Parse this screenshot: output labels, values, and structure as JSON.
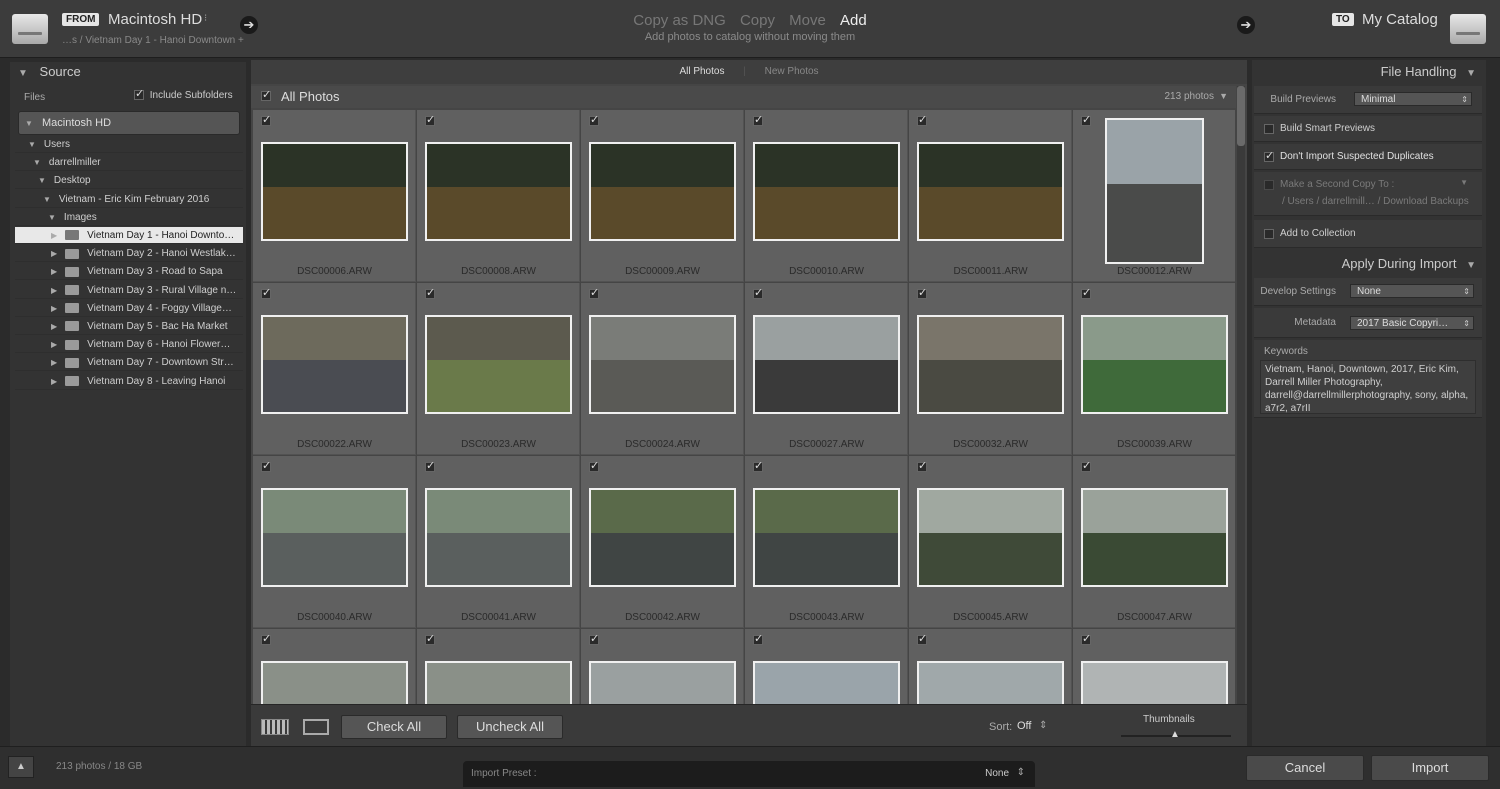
{
  "top": {
    "from_tag": "FROM",
    "from_volume": "Macintosh HD",
    "from_path": "…s / Vietnam Day 1 - Hanoi Downtown +",
    "modes": [
      "Copy as DNG",
      "Copy",
      "Move",
      "Add"
    ],
    "active_mode": "Add",
    "mode_description": "Add photos to catalog without moving them",
    "to_tag": "TO",
    "to_destination": "My Catalog"
  },
  "source": {
    "title": "Source",
    "files_label": "Files",
    "include_subfolders": "Include Subfolders",
    "volume": "Macintosh HD",
    "tree": [
      {
        "label": "Users",
        "indent": 1,
        "kind": "node"
      },
      {
        "label": "darrellmiller",
        "indent": 2,
        "kind": "node"
      },
      {
        "label": "Desktop",
        "indent": 3,
        "kind": "node"
      },
      {
        "label": "Vietnam - Eric Kim February 2016",
        "indent": 4,
        "kind": "node"
      },
      {
        "label": "Images",
        "indent": 5,
        "kind": "node"
      },
      {
        "label": "Vietnam Day 1 - Hanoi Downto…",
        "indent": 6,
        "kind": "folder",
        "selected": true
      },
      {
        "label": "Vietnam Day 2 - Hanoi Westlak…",
        "indent": 6,
        "kind": "folder"
      },
      {
        "label": "Vietnam Day 3 - Road to Sapa",
        "indent": 6,
        "kind": "folder"
      },
      {
        "label": "Vietnam Day 3 - Rural Village n…",
        "indent": 6,
        "kind": "folder"
      },
      {
        "label": "Vietnam Day 4 - Foggy Village…",
        "indent": 6,
        "kind": "folder"
      },
      {
        "label": "Vietnam Day 5 - Bac Ha Market",
        "indent": 6,
        "kind": "folder"
      },
      {
        "label": "Vietnam Day 6 - Hanoi Flower…",
        "indent": 6,
        "kind": "folder"
      },
      {
        "label": "Vietnam Day 7 - Downtown Str…",
        "indent": 6,
        "kind": "folder"
      },
      {
        "label": "Vietnam Day 8 - Leaving Hanoi",
        "indent": 6,
        "kind": "folder"
      }
    ]
  },
  "view_tabs": [
    "All Photos",
    "New Photos"
  ],
  "grid": {
    "header_label": "All Photos",
    "count": "213 photos",
    "rows": [
      [
        {
          "name": "DSC00006.ARW",
          "sky": "#2b3326",
          "ground": "#5a4a2a"
        },
        {
          "name": "DSC00008.ARW",
          "sky": "#2b3326",
          "ground": "#5a4a2a"
        },
        {
          "name": "DSC00009.ARW",
          "sky": "#2b3326",
          "ground": "#5a4a2a"
        },
        {
          "name": "DSC00010.ARW",
          "sky": "#2b3326",
          "ground": "#5a4a2a"
        },
        {
          "name": "DSC00011.ARW",
          "sky": "#2b3326",
          "ground": "#5a4a2a"
        },
        {
          "name": "DSC00012.ARW",
          "sky": "#9aa3a8",
          "ground": "#4a4b4a",
          "portrait": true
        }
      ],
      [
        {
          "name": "DSC00022.ARW",
          "sky": "#6d6a5c",
          "ground": "#4a4c52"
        },
        {
          "name": "DSC00023.ARW",
          "sky": "#5c5a4e",
          "ground": "#6a7a4a"
        },
        {
          "name": "DSC00024.ARW",
          "sky": "#7a7c78",
          "ground": "#5a5a56"
        },
        {
          "name": "DSC00027.ARW",
          "sky": "#9aa0a0",
          "ground": "#3a3a3a"
        },
        {
          "name": "DSC00032.ARW",
          "sky": "#7a756a",
          "ground": "#4a4a42"
        },
        {
          "name": "DSC00039.ARW",
          "sky": "#8a9a8a",
          "ground": "#3f6a3a"
        }
      ],
      [
        {
          "name": "DSC00040.ARW",
          "sky": "#7a8a78",
          "ground": "#5a5f5e"
        },
        {
          "name": "DSC00041.ARW",
          "sky": "#7a8a78",
          "ground": "#5a5f5e"
        },
        {
          "name": "DSC00042.ARW",
          "sky": "#5a6a4a",
          "ground": "#404544"
        },
        {
          "name": "DSC00043.ARW",
          "sky": "#5a6a4a",
          "ground": "#404544"
        },
        {
          "name": "DSC00045.ARW",
          "sky": "#a0a8a0",
          "ground": "#3f4a38"
        },
        {
          "name": "DSC00047.ARW",
          "sky": "#9aa29a",
          "ground": "#3a4a34"
        }
      ],
      [
        {
          "name": "",
          "sky": "#8a9088",
          "ground": "#3f4a38"
        },
        {
          "name": "",
          "sky": "#8a9088",
          "ground": "#3f4a38"
        },
        {
          "name": "",
          "sky": "#9aa0a0",
          "ground": "#4a4c48"
        },
        {
          "name": "",
          "sky": "#9aa4aa",
          "ground": "#2a2a2a"
        },
        {
          "name": "",
          "sky": "#a0a8aa",
          "ground": "#3a4a38"
        },
        {
          "name": "",
          "sky": "#b0b4b4",
          "ground": "#4a4a44"
        }
      ]
    ]
  },
  "toolbar": {
    "check_all": "Check All",
    "uncheck_all": "Uncheck All",
    "sort_label": "Sort:",
    "sort_value": "Off",
    "thumbnails_label": "Thumbnails"
  },
  "file_handling": {
    "title": "File Handling",
    "build_previews_label": "Build Previews",
    "build_previews_value": "Minimal",
    "smart_previews": "Build Smart Previews",
    "dont_import_dupes": "Don't Import Suspected Duplicates",
    "second_copy": "Make a Second Copy To :",
    "second_copy_path": "/ Users / darrellmill… / Download Backups",
    "add_to_collection": "Add to Collection"
  },
  "apply_during_import": {
    "title": "Apply During Import",
    "develop_label": "Develop Settings",
    "develop_value": "None",
    "metadata_label": "Metadata",
    "metadata_value": "2017 Basic Copyri…",
    "keywords_label": "Keywords",
    "keywords_value": "Vietnam, Hanoi, Downtown, 2017, Eric Kim, Darrell Miller Photography, darrell@darrellmillerphotography, sony, alpha, a7r2, a7rII"
  },
  "bottom": {
    "summary": "213 photos / 18 GB",
    "import_preset_label": "Import Preset :",
    "import_preset_value": "None",
    "cancel": "Cancel",
    "import": "Import"
  }
}
